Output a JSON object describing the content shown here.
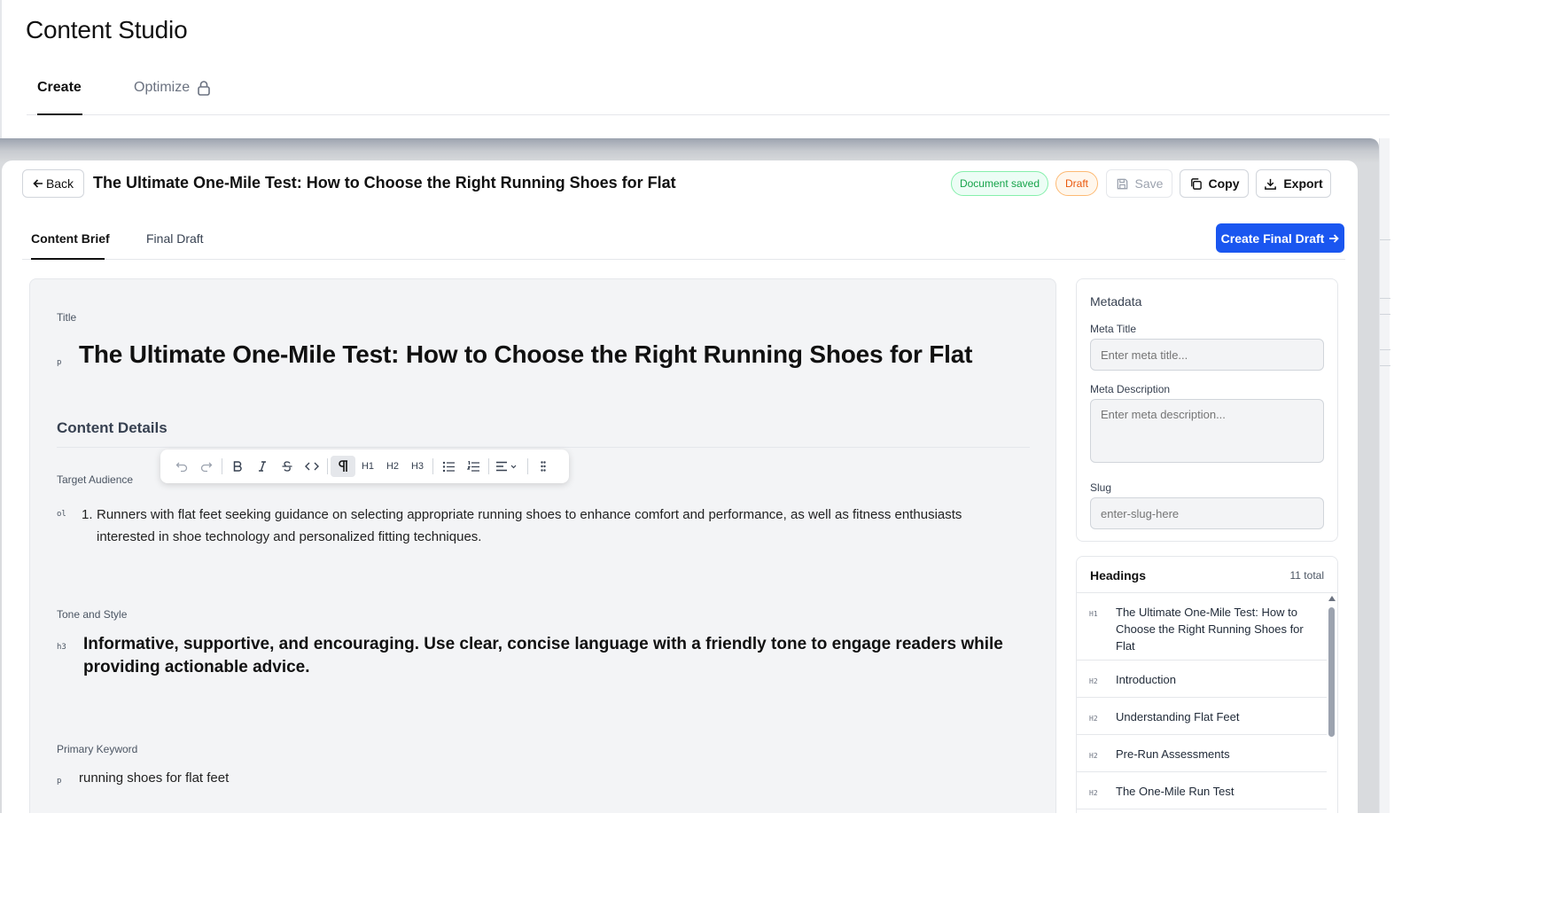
{
  "app": {
    "title": "Content Studio",
    "tabs": [
      {
        "label": "Create",
        "active": true
      },
      {
        "label": "Optimize",
        "locked": true
      }
    ]
  },
  "modal": {
    "back_label": "Back",
    "document_title": "The Ultimate One-Mile Test: How to Choose the Right Running Shoes for Flat",
    "status_saved": "Document saved",
    "status_draft": "Draft",
    "save_label": "Save",
    "copy_label": "Copy",
    "export_label": "Export",
    "tabs": [
      {
        "label": "Content Brief",
        "active": true
      },
      {
        "label": "Final Draft",
        "active": false
      }
    ],
    "create_final_label": "Create Final Draft",
    "colors": {
      "primary": "#1a56f0",
      "saved": "#16a34a",
      "draft": "#ea580c"
    }
  },
  "editor": {
    "title_label": "Title",
    "title_tag": "p",
    "title_text": "The Ultimate One-Mile Test: How to Choose the Right Running Shoes for Flat",
    "section_heading": "Content Details",
    "toolbar": {
      "icons": [
        "undo-icon",
        "redo-icon",
        "bold-icon",
        "italic-icon",
        "strikethrough-icon",
        "code-icon",
        "paragraph-icon",
        "heading-1-icon",
        "heading-2-icon",
        "heading-3-icon",
        "bullet-list-icon",
        "ordered-list-icon",
        "align-icon",
        "drag-handle-icon"
      ],
      "active": "paragraph-icon",
      "h1": "H1",
      "h2": "H2",
      "h3": "H3"
    },
    "target_audience_label": "Target Audience",
    "target_audience_tag": "ol",
    "target_audience_number": "1.",
    "target_audience_text": "Runners with flat feet seeking guidance on selecting appropriate running shoes to enhance comfort and performance, as well as fitness enthusiasts interested in shoe technology and personalized fitting techniques.",
    "tone_label": "Tone and Style",
    "tone_tag": "h3",
    "tone_text": "Informative, supportive, and encouraging. Use clear, concise language with a friendly tone to engage readers while providing actionable advice.",
    "keyword_label": "Primary Keyword",
    "keyword_tag": "p",
    "keyword_text": "running shoes for flat feet"
  },
  "metadata": {
    "heading": "Metadata",
    "meta_title_label": "Meta Title",
    "meta_title_placeholder": "Enter meta title...",
    "meta_description_label": "Meta Description",
    "meta_description_placeholder": "Enter meta description...",
    "slug_label": "Slug",
    "slug_placeholder": "enter-slug-here"
  },
  "headings": {
    "title": "Headings",
    "count": "11 total",
    "items": [
      {
        "level": "H1",
        "text": "The Ultimate One-Mile Test: How to Choose the Right Running Shoes for Flat"
      },
      {
        "level": "H2",
        "text": "Introduction"
      },
      {
        "level": "H2",
        "text": "Understanding Flat Feet"
      },
      {
        "level": "H2",
        "text": "Pre-Run Assessments"
      },
      {
        "level": "H2",
        "text": "The One-Mile Run Test"
      }
    ]
  }
}
